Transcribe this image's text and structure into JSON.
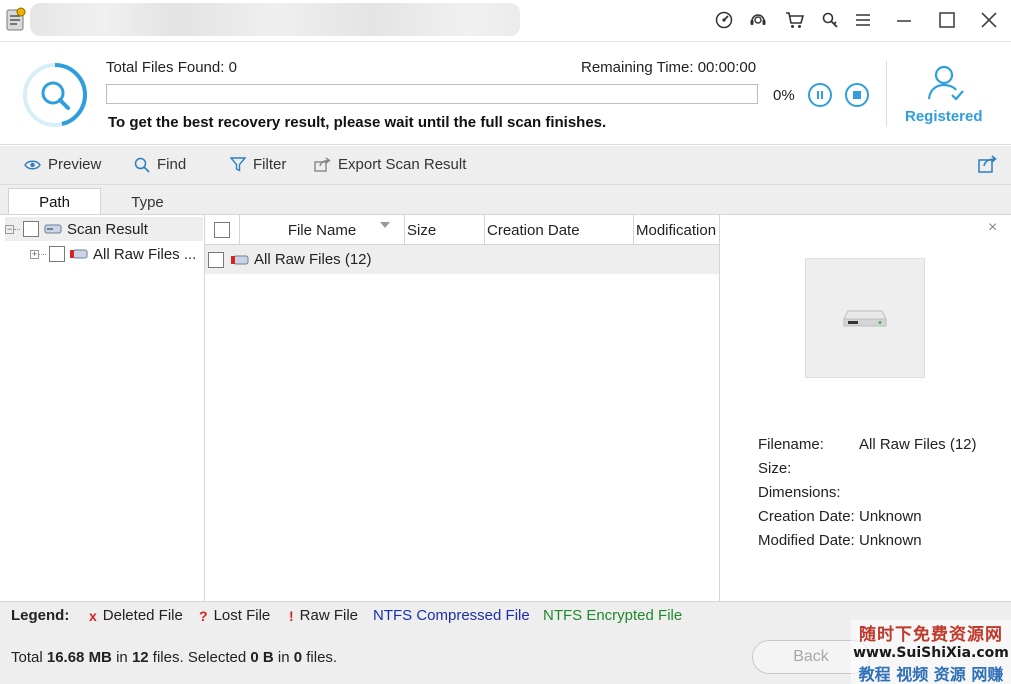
{
  "window": {
    "buttons": [
      "minimize",
      "maximize",
      "close"
    ],
    "title_icons": [
      "speed-icon",
      "support-icon",
      "cart-icon",
      "key-icon",
      "menu-icon"
    ]
  },
  "scan": {
    "found_label": "Total Files Found:",
    "found_value": "0",
    "remaining_label": "Remaining Time:",
    "remaining_value": "00:00:00",
    "percent": "0%",
    "progress_fraction": 0.0,
    "hint": "To get the best recovery result, please wait until the full scan finishes.",
    "accent_color": "#2e9fdc"
  },
  "account": {
    "status": "Registered"
  },
  "toolbar": {
    "preview": "Preview",
    "find": "Find",
    "filter": "Filter",
    "export": "Export Scan Result"
  },
  "tabs": [
    {
      "label": "Path",
      "active": true
    },
    {
      "label": "Type",
      "active": false
    }
  ],
  "tree": {
    "root": "Scan Result",
    "child": "All Raw Files ..."
  },
  "filelist": {
    "columns": [
      "File Name",
      "Size",
      "Creation Date",
      "Modification"
    ],
    "rows": [
      {
        "name": "All Raw Files (12)"
      }
    ]
  },
  "preview": {
    "properties": [
      {
        "label": "Filename:",
        "value": "All Raw Files (12)"
      },
      {
        "label": "Size:",
        "value": ""
      },
      {
        "label": "Dimensions:",
        "value": ""
      },
      {
        "label": "Creation Date:",
        "value": "Unknown"
      },
      {
        "label": "Modified Date:",
        "value": "Unknown"
      }
    ]
  },
  "legend": {
    "title": "Legend:",
    "deleted_mark": "x",
    "deleted": "Deleted File",
    "lost_mark": "?",
    "lost": "Lost File",
    "raw_mark": "!",
    "raw": "Raw File",
    "ntfs_compressed": "NTFS Compressed File",
    "ntfs_compressed_color": "#1d2fa8",
    "ntfs_encrypted": "NTFS Encrypted File",
    "ntfs_encrypted_color": "#1e8a2a"
  },
  "status": {
    "total_prefix": "Total",
    "total_size": "16.68 MB",
    "in1": "in",
    "total_files": "12",
    "files1": "files.",
    "selected_prefix": "Selected",
    "selected_size": "0 B",
    "in2": "in",
    "selected_files": "0",
    "files2": "files."
  },
  "nav": {
    "back": "Back"
  },
  "watermark": {
    "line1": "随时下免费资源网",
    "line2": "www.SuiShiXia.com",
    "line3": "教程 视频 资源 网赚"
  }
}
